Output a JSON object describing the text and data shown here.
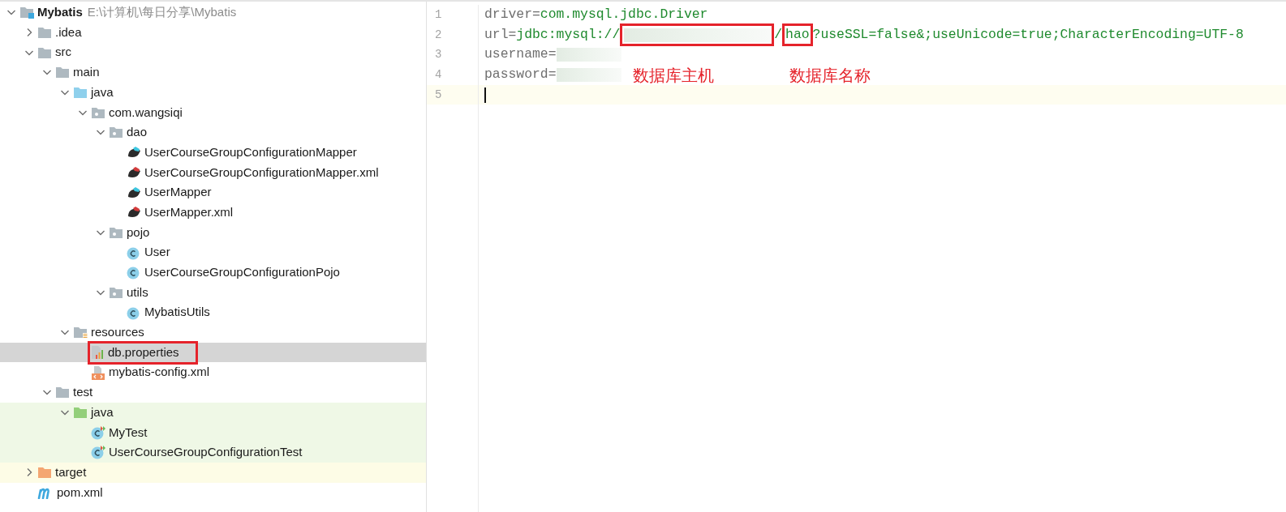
{
  "project_tree": {
    "root": {
      "label": "Mybatis",
      "path": "E:\\计算机\\每日分享\\Mybatis",
      "kind": "project",
      "expanded": true,
      "selected": false,
      "children": [
        {
          "label": ".idea",
          "kind": "folder",
          "expanded": false,
          "selected": false
        },
        {
          "label": "src",
          "kind": "folder",
          "expanded": true,
          "selected": false,
          "children": [
            {
              "label": "main",
              "kind": "folder",
              "expanded": true,
              "selected": false,
              "children": [
                {
                  "label": "java",
                  "kind": "source-folder",
                  "expanded": true,
                  "selected": false,
                  "children": [
                    {
                      "label": "com.wangsiqi",
                      "kind": "package",
                      "expanded": true,
                      "selected": false,
                      "children": [
                        {
                          "label": "dao",
                          "kind": "package",
                          "expanded": true,
                          "selected": false,
                          "children": [
                            {
                              "label": "UserCourseGroupConfigurationMapper",
                              "kind": "mapper",
                              "selected": false
                            },
                            {
                              "label": "UserCourseGroupConfigurationMapper.xml",
                              "kind": "mapper-xml",
                              "selected": false
                            },
                            {
                              "label": "UserMapper",
                              "kind": "mapper",
                              "selected": false
                            },
                            {
                              "label": "UserMapper.xml",
                              "kind": "mapper-xml",
                              "selected": false
                            }
                          ]
                        },
                        {
                          "label": "pojo",
                          "kind": "package",
                          "expanded": true,
                          "selected": false,
                          "children": [
                            {
                              "label": "User",
                              "kind": "class",
                              "selected": false
                            },
                            {
                              "label": "UserCourseGroupConfigurationPojo",
                              "kind": "class",
                              "selected": false
                            }
                          ]
                        },
                        {
                          "label": "utils",
                          "kind": "package",
                          "expanded": true,
                          "selected": false,
                          "children": [
                            {
                              "label": "MybatisUtils",
                              "kind": "class",
                              "selected": false
                            }
                          ]
                        }
                      ]
                    }
                  ]
                },
                {
                  "label": "resources",
                  "kind": "resources-folder",
                  "expanded": true,
                  "selected": false,
                  "children": [
                    {
                      "label": "db.properties",
                      "kind": "properties",
                      "selected": true,
                      "annotated": true
                    },
                    {
                      "label": "mybatis-config.xml",
                      "kind": "xml",
                      "selected": false
                    }
                  ]
                }
              ]
            },
            {
              "label": "test",
              "kind": "folder",
              "expanded": true,
              "selected": false,
              "children": [
                {
                  "label": "java",
                  "kind": "test-folder",
                  "expanded": true,
                  "selected": false,
                  "color": "#eff8e6",
                  "children": [
                    {
                      "label": "MyTest",
                      "kind": "test-class",
                      "selected": false,
                      "color": "#eff8e6"
                    },
                    {
                      "label": "UserCourseGroupConfigurationTest",
                      "kind": "test-class",
                      "selected": false,
                      "color": "#eff8e6"
                    }
                  ]
                }
              ]
            }
          ]
        },
        {
          "label": "target",
          "kind": "excluded-folder",
          "expanded": false,
          "selected": false,
          "color": "#fdfce6"
        },
        {
          "label": "pom.xml",
          "kind": "maven",
          "selected": false
        }
      ]
    }
  },
  "editor": {
    "lines": [
      {
        "number": "1",
        "current": false,
        "segments": [
          {
            "kind": "key",
            "text": "driver="
          },
          {
            "kind": "value",
            "text": "com.mysql.jdbc.Driver"
          }
        ]
      },
      {
        "number": "2",
        "current": false,
        "segments": [
          {
            "kind": "key",
            "text": "url="
          },
          {
            "kind": "value",
            "text": "jdbc:mysql://"
          },
          {
            "kind": "redacted",
            "boxed": true
          },
          {
            "kind": "value",
            "text": "/"
          },
          {
            "kind": "value",
            "text": "hao",
            "boxed": true
          },
          {
            "kind": "value",
            "text": "?useSSL=false&;useUnicode=true;CharacterEncoding=UTF-8"
          }
        ]
      },
      {
        "number": "3",
        "current": false,
        "segments": [
          {
            "kind": "key",
            "text": "username="
          },
          {
            "kind": "redacted"
          }
        ]
      },
      {
        "number": "4",
        "current": false,
        "segments": [
          {
            "kind": "key",
            "text": "password="
          },
          {
            "kind": "redacted"
          }
        ]
      },
      {
        "number": "5",
        "current": true
      }
    ],
    "annotations": [
      "数据库主机",
      "数据库名称"
    ]
  }
}
